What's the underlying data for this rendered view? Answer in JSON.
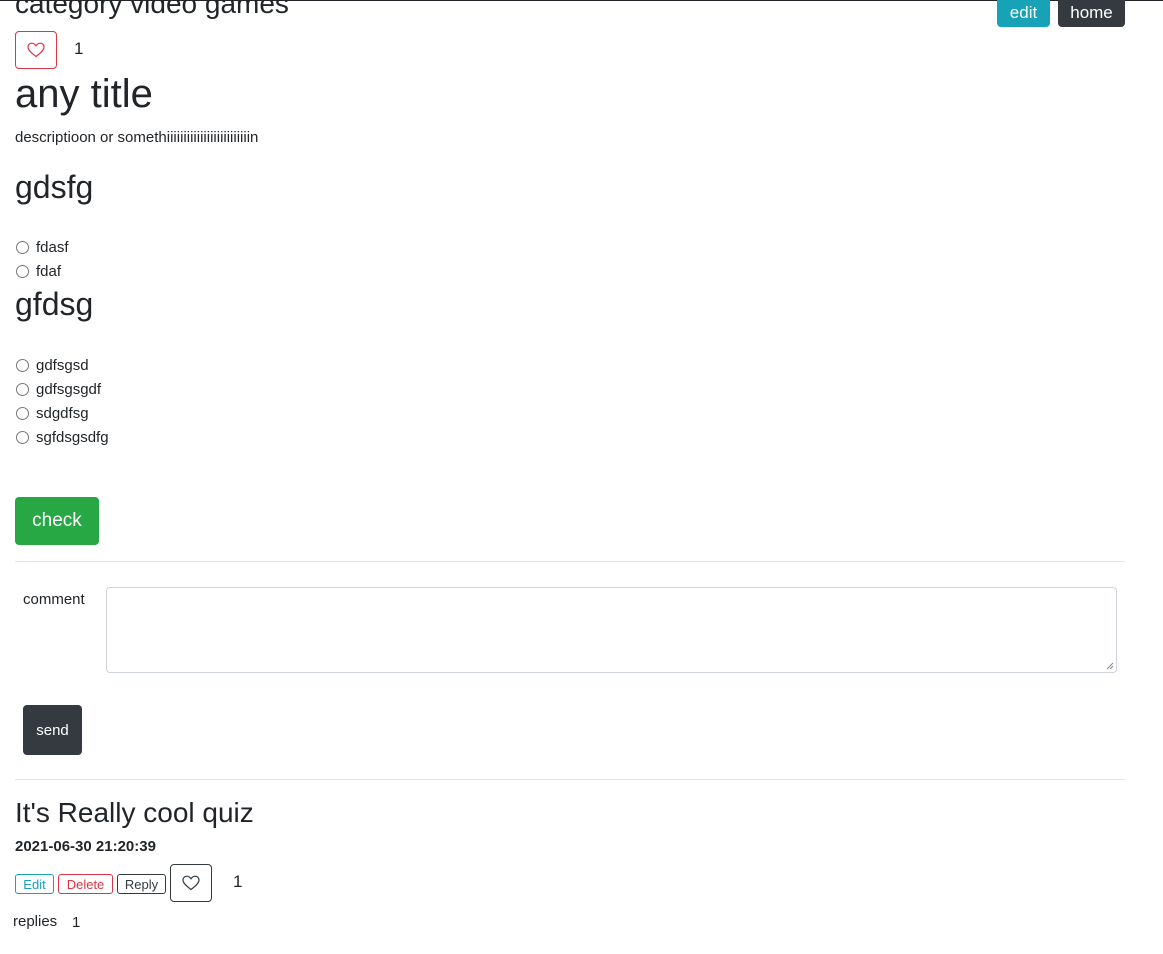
{
  "header": {
    "category_title": "category video games",
    "edit_label": "edit",
    "home_label": "home"
  },
  "quiz": {
    "like_count": "1",
    "title": "any title",
    "description": "descriptioon or somethiiiiiiiiiiiiiiiiiiiiiiiiin",
    "questions": [
      {
        "title": "gdsfg",
        "options": [
          "fdasf",
          "fdaf"
        ]
      },
      {
        "title": "gfdsg",
        "options": [
          "gdfsgsd",
          "gdfsgsgdf",
          "sdgdfsg",
          "sgfdsgsdfg"
        ]
      }
    ],
    "check_label": "check"
  },
  "comment_form": {
    "label": "comment",
    "value": "",
    "send_label": "send"
  },
  "comments": [
    {
      "text": "It's Really cool quiz",
      "timestamp": "2021-06-30 21:20:39",
      "edit_label": "Edit",
      "delete_label": "Delete",
      "reply_label": "Reply",
      "like_count": "1",
      "replies_label": "replies",
      "replies_count": "1"
    }
  ],
  "colors": {
    "info": "#17a2b8",
    "dark": "#343a40",
    "success": "#28a745",
    "danger": "#dc3545"
  },
  "icons": {
    "like": "heart-outline-icon"
  }
}
